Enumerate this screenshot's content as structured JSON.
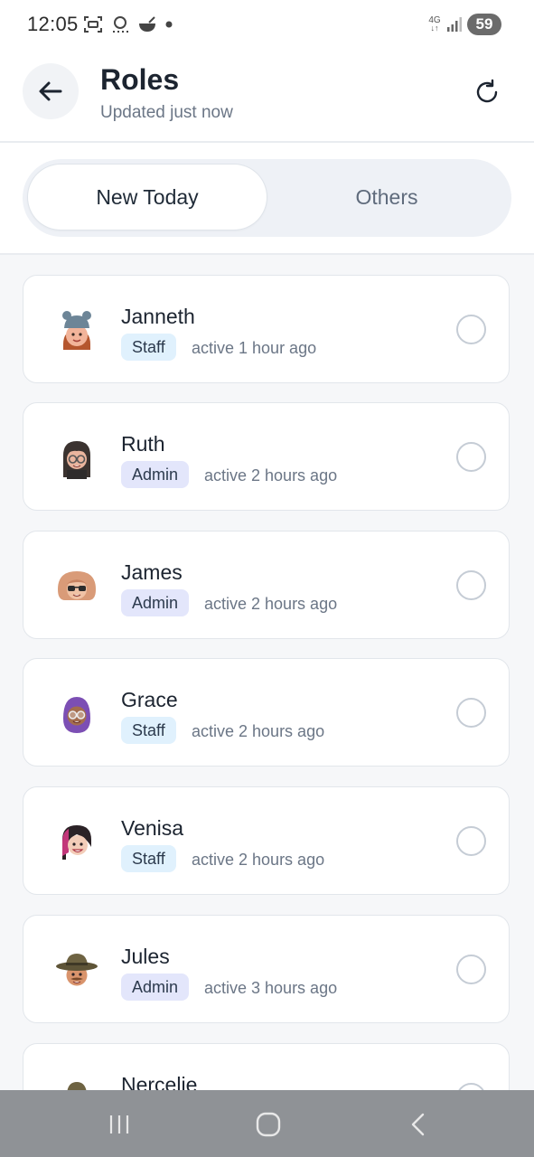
{
  "status": {
    "time": "12:05",
    "network": "4G",
    "battery": "59"
  },
  "header": {
    "title": "Roles",
    "subtitle": "Updated just now"
  },
  "tabs": [
    {
      "label": "New Today",
      "active": true
    },
    {
      "label": "Others",
      "active": false
    }
  ],
  "users": [
    {
      "name": "Janneth",
      "role": "Staff",
      "activity": "active 1 hour ago",
      "avatar": "memoji-woman-beanie"
    },
    {
      "name": "Ruth",
      "role": "Admin",
      "activity": "active 2 hours ago",
      "avatar": "memoji-woman-glasses"
    },
    {
      "name": "James",
      "role": "Admin",
      "activity": "active 2 hours ago",
      "avatar": "memoji-man-sunglasses"
    },
    {
      "name": "Grace",
      "role": "Staff",
      "activity": "active 2 hours ago",
      "avatar": "memoji-woman-hijab"
    },
    {
      "name": "Venisa",
      "role": "Staff",
      "activity": "active 2 hours ago",
      "avatar": "memoji-woman-smile"
    },
    {
      "name": "Jules",
      "role": "Admin",
      "activity": "active 3 hours ago",
      "avatar": "memoji-man-hat"
    },
    {
      "name": "Nercelie",
      "role": "",
      "activity": "",
      "avatar": "memoji-hat"
    }
  ],
  "colors": {
    "staff_badge": "#e0f1fd",
    "admin_badge": "#e3e6fb",
    "list_background": "#f6f7f9",
    "nav_bar": "#8f9296"
  }
}
